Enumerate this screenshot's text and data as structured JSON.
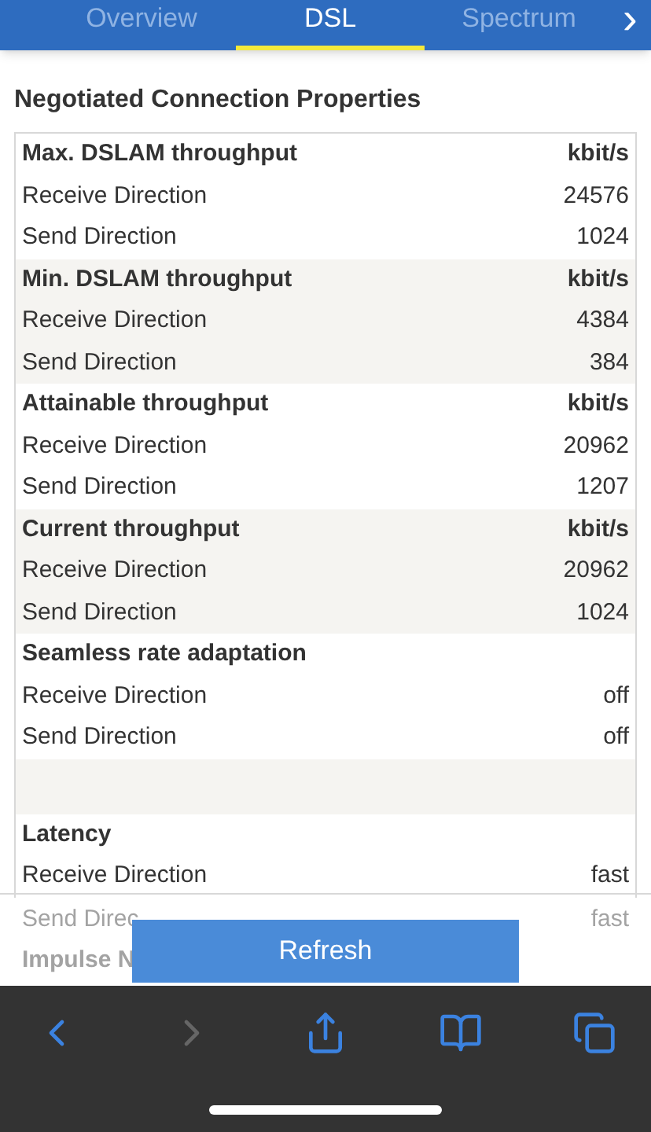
{
  "tabs": [
    {
      "label": "Overview",
      "selected": false
    },
    {
      "label": "DSL",
      "selected": true
    },
    {
      "label": "Spectrum",
      "selected": false
    }
  ],
  "next_tab_icon": "›",
  "title": "Negotiated Connection Properties",
  "groups": [
    {
      "kind": "group",
      "title": "Max. DSLAM throughput",
      "unit": "kbit/s",
      "shaded": false,
      "rows": [
        {
          "label": "Receive Direction",
          "value": "24576"
        },
        {
          "label": "Send Direction",
          "value": "1024"
        }
      ]
    },
    {
      "kind": "group",
      "title": "Min. DSLAM throughput",
      "unit": "kbit/s",
      "shaded": true,
      "rows": [
        {
          "label": "Receive Direction",
          "value": "4384"
        },
        {
          "label": "Send Direction",
          "value": "384"
        }
      ]
    },
    {
      "kind": "group",
      "title": "Attainable throughput",
      "unit": "kbit/s",
      "shaded": false,
      "rows": [
        {
          "label": "Receive Direction",
          "value": "20962"
        },
        {
          "label": "Send Direction",
          "value": "1207"
        }
      ]
    },
    {
      "kind": "group",
      "title": "Current throughput",
      "unit": "kbit/s",
      "shaded": true,
      "rows": [
        {
          "label": "Receive Direction",
          "value": "20962"
        },
        {
          "label": "Send Direction",
          "value": "1024"
        }
      ]
    },
    {
      "kind": "group",
      "title": "Seamless rate adaptation",
      "shaded": false,
      "rows": [
        {
          "label": "Receive Direction",
          "value": "off"
        },
        {
          "label": "Send Direction",
          "value": "off"
        }
      ]
    },
    {
      "kind": "spacer",
      "shaded": true
    },
    {
      "kind": "group",
      "title": "Latency",
      "shaded": false,
      "rows": [
        {
          "label": "Receive Direction",
          "value": "fast"
        }
      ]
    }
  ],
  "faded_rows": [
    {
      "label": "Send Direc",
      "value": "fast"
    },
    {
      "label": "Impulse N"
    }
  ],
  "refresh_button": "Refresh"
}
